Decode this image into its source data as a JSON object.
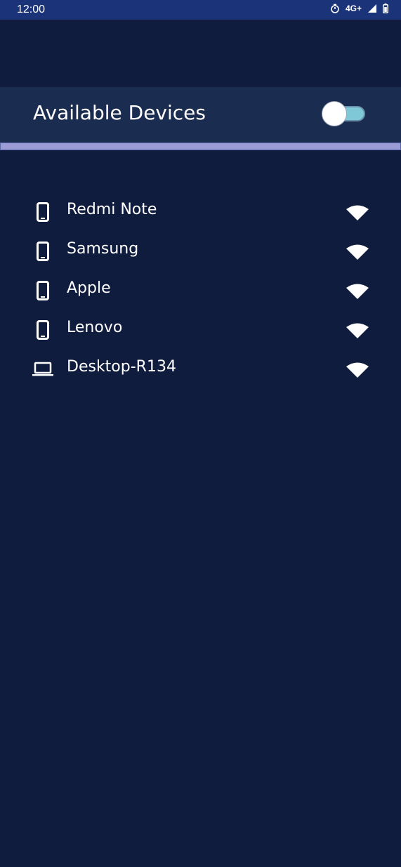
{
  "status_bar": {
    "time": "12:00",
    "network": "4G+",
    "icons": [
      "timer-icon",
      "signal-icon",
      "battery-icon"
    ]
  },
  "header": {
    "title": "Available Devices",
    "toggle_on": false
  },
  "devices": [
    {
      "name": "Redmi Note",
      "type_icon": "phone-icon",
      "wifi_icon": "wifi-icon"
    },
    {
      "name": "Samsung",
      "type_icon": "phone-icon",
      "wifi_icon": "wifi-icon"
    },
    {
      "name": "Apple",
      "type_icon": "phone-icon",
      "wifi_icon": "wifi-icon"
    },
    {
      "name": "Lenovo",
      "type_icon": "phone-icon",
      "wifi_icon": "wifi-icon"
    },
    {
      "name": "Desktop-R134",
      "type_icon": "laptop-icon",
      "wifi_icon": "wifi-icon"
    }
  ],
  "colors": {
    "background": "#0f1c3d",
    "status_bar": "#1b3378",
    "header": "#1a2d50",
    "underline": "#9b9bd6",
    "toggle_track": "#7ec8d8",
    "text": "#ffffff"
  }
}
